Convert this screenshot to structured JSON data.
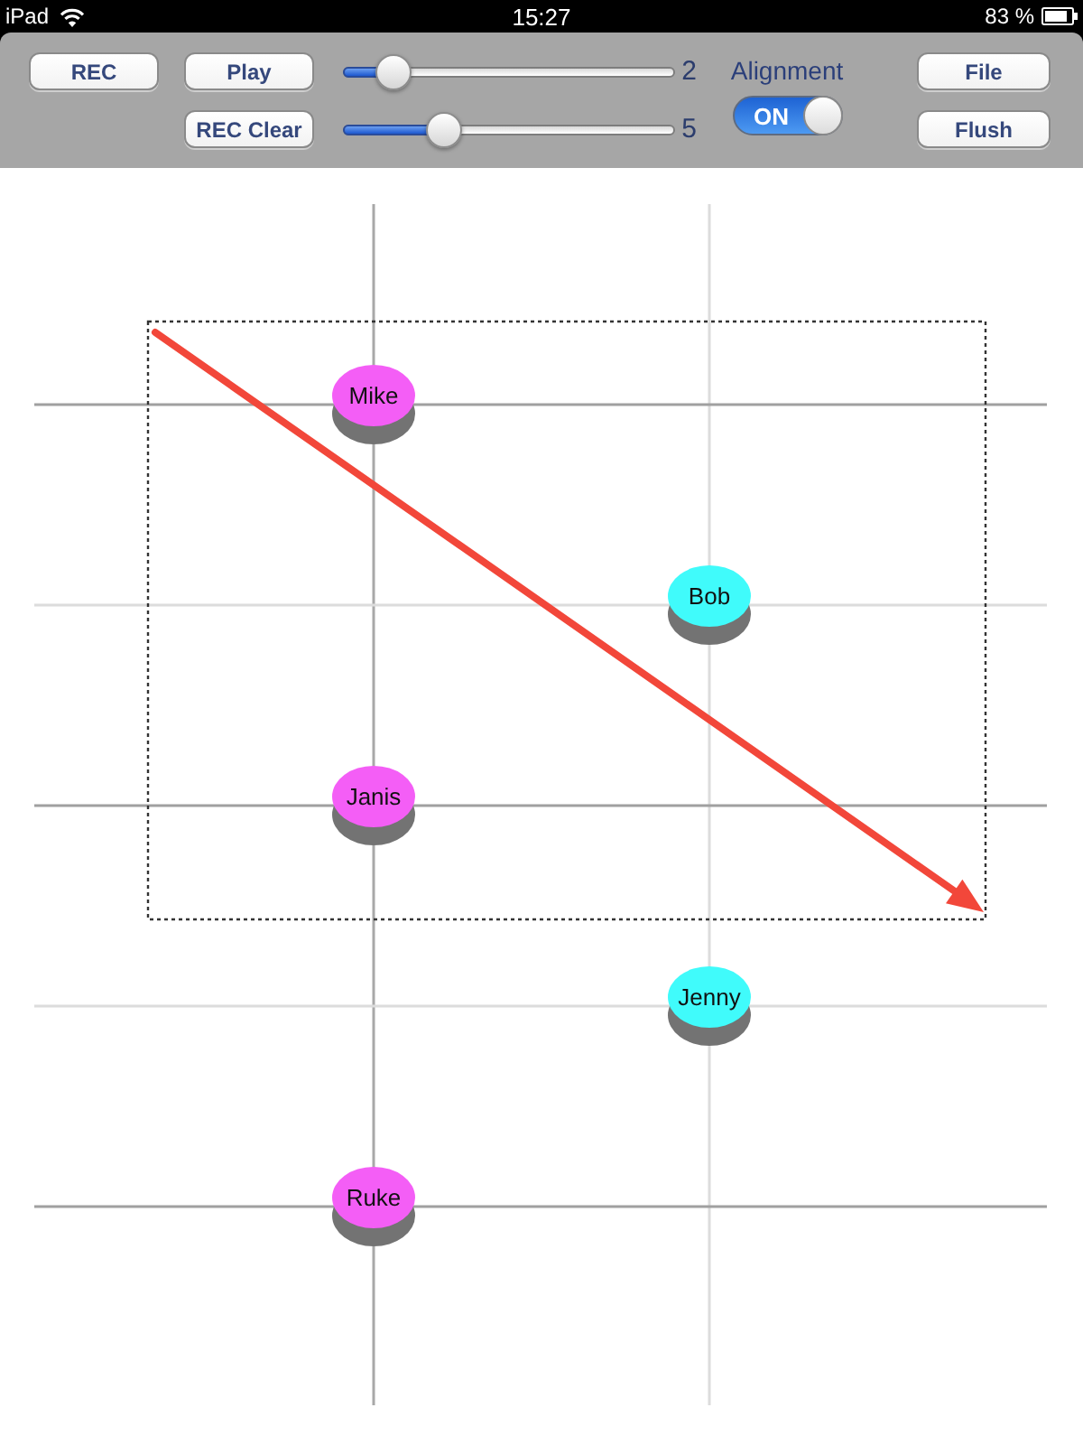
{
  "status_bar": {
    "device": "iPad",
    "time": "15:27",
    "battery": "83 %"
  },
  "toolbar": {
    "button_columns": [
      [
        "REC"
      ],
      [
        "Play",
        "REC Clear"
      ]
    ],
    "sliders": [
      {
        "level": 0.11,
        "reading": "2"
      },
      {
        "level": 0.28,
        "reading": "5"
      }
    ],
    "alignment": {
      "label": "Alignment",
      "on": true,
      "switch_text": "ON"
    },
    "side_buttons": [
      "File",
      "Flush"
    ]
  },
  "canvas": {
    "nodes": [
      {
        "name": "Mike",
        "color": "#f45ef6"
      },
      {
        "name": "Bob",
        "color": "#40fbfb"
      },
      {
        "name": "Janis",
        "color": "#f45ef6"
      },
      {
        "name": "Jenny",
        "color": "#40fbfb"
      },
      {
        "name": "Ruke",
        "color": "#f45ef6"
      }
    ]
  }
}
